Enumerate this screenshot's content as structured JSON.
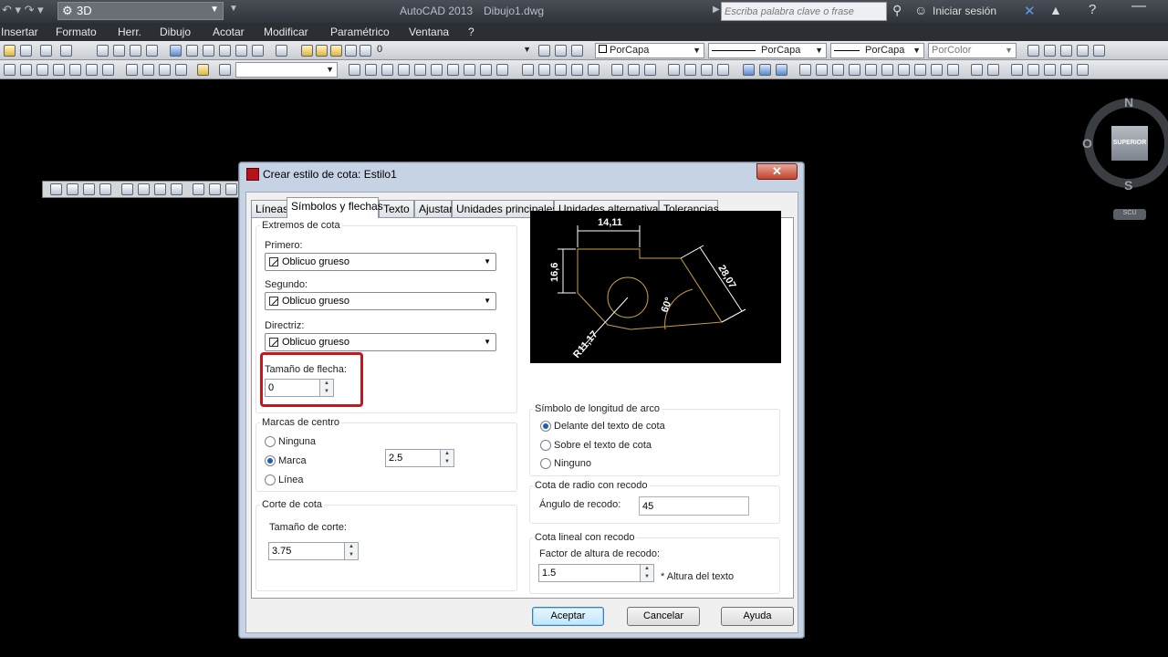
{
  "title_bar": {
    "workspace": "3D",
    "app_title": "AutoCAD 2013",
    "file_name": "Dibujo1.dwg",
    "search_placeholder": "Escriba palabra clave o frase",
    "signin": "Iniciar sesión"
  },
  "menu": [
    "Insertar",
    "Formato",
    "Herr.",
    "Dibujo",
    "Acotar",
    "Modificar",
    "Paramétrico",
    "Ventana",
    "?"
  ],
  "props_toolbar": {
    "layer": "0",
    "color": "PorCapa",
    "linetype": "PorCapa",
    "lineweight": "PorCapa",
    "plotstyle": "PorColor"
  },
  "viewcube": {
    "n": "N",
    "s": "S",
    "w": "O",
    "face": "SUPERIOR",
    "ucs": "SCU"
  },
  "dialog": {
    "title": "Crear estilo de cota: Estilo1",
    "tabs": [
      "Líneas",
      "Símbolos y flechas",
      "Texto",
      "Ajustar",
      "Unidades principales",
      "Unidades alternativas",
      "Tolerancias"
    ],
    "active_tab": 1,
    "arrowheads": {
      "group_label": "Extremos de cota",
      "first_label": "Primero:",
      "first_value": "Oblicuo grueso",
      "second_label": "Segundo:",
      "second_value": "Oblicuo grueso",
      "leader_label": "Directriz:",
      "leader_value": "Oblicuo grueso",
      "size_label": "Tamaño de flecha:",
      "size_value": "0"
    },
    "center_marks": {
      "group_label": "Marcas de centro",
      "options": [
        "Ninguna",
        "Marca",
        "Línea"
      ],
      "selected": 1,
      "value": "2.5"
    },
    "dim_break": {
      "group_label": "Corte de cota",
      "size_label": "Tamaño de corte:",
      "size_value": "3.75"
    },
    "preview": {
      "dim_top": "14,11",
      "dim_left": "16,6",
      "dim_right": "28,07",
      "dim_angle": "60°",
      "dim_radius": "R11,17"
    },
    "arc_length": {
      "group_label": "Símbolo de longitud de arco",
      "options": [
        "Delante del texto de cota",
        "Sobre el texto de cota",
        "Ninguno"
      ],
      "selected": 0
    },
    "radius_jog": {
      "group_label": "Cota de radio con recodo",
      "angle_label": "Ángulo de recodo:",
      "angle_value": "45"
    },
    "linear_jog": {
      "group_label": "Cota lineal con recodo",
      "factor_label": "Factor de altura de recodo:",
      "factor_value": "1.5",
      "factor_suffix": "* Altura del texto"
    },
    "buttons": {
      "ok": "Aceptar",
      "cancel": "Cancelar",
      "help": "Ayuda"
    }
  },
  "colors": {
    "highlight": "#c8161d",
    "preview_geometry": "#c8a040",
    "dialog_frame": "#c5d3e5"
  }
}
